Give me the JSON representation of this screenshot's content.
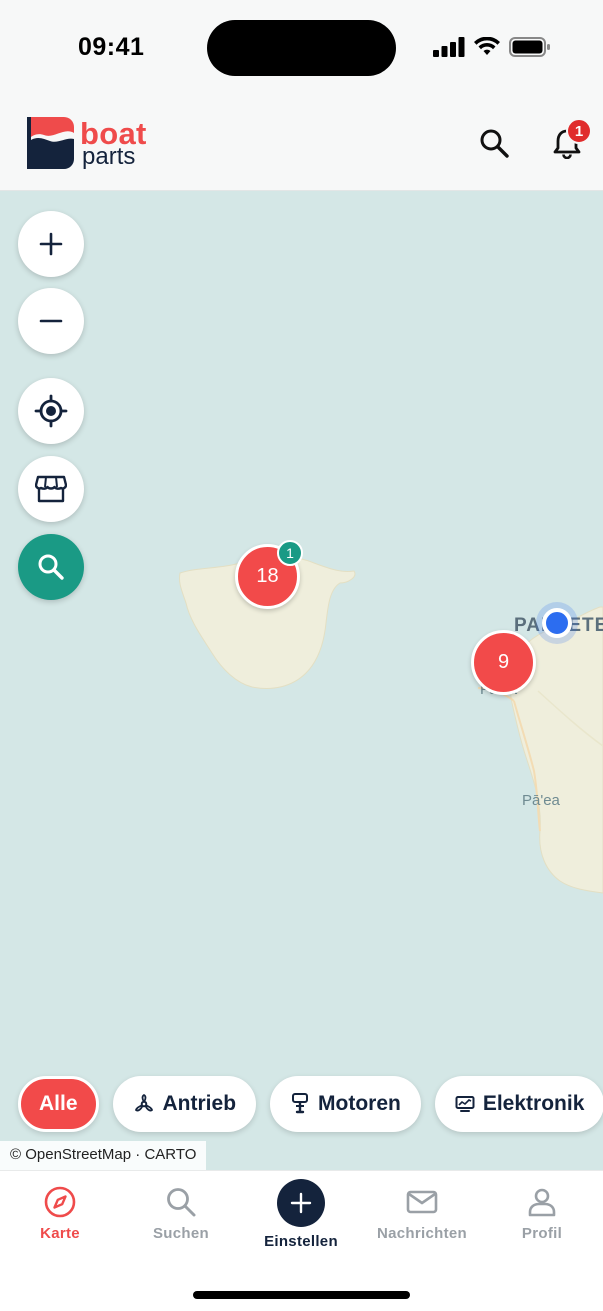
{
  "status_bar": {
    "time": "09:41"
  },
  "header": {
    "logo": {
      "word1": "boat",
      "word2": "parts"
    },
    "notification_count": "1"
  },
  "map": {
    "places": [
      "PAPEETE",
      "Faa'a",
      "Pā'ea"
    ],
    "clusters": [
      {
        "count": "18",
        "badge": "1"
      },
      {
        "count": "9"
      }
    ],
    "attribution": "© OpenStreetMap · CARTO"
  },
  "map_controls": [
    "zoom-in",
    "zoom-out",
    "locate",
    "shops",
    "search"
  ],
  "categories": [
    {
      "label": "Alle",
      "active": true
    },
    {
      "label": "Antrieb",
      "icon": "propeller-icon"
    },
    {
      "label": "Motoren",
      "icon": "outboard-motor-icon"
    },
    {
      "label": "Elektronik",
      "icon": "monitor-icon"
    }
  ],
  "nav": [
    {
      "label": "Karte",
      "icon": "compass-icon",
      "active": true
    },
    {
      "label": "Suchen",
      "icon": "search-icon"
    },
    {
      "label": "Einstellen",
      "icon": "plus-icon"
    },
    {
      "label": "Nachrichten",
      "icon": "mail-icon"
    },
    {
      "label": "Profil",
      "icon": "user-icon"
    }
  ],
  "colors": {
    "brand_red": "#f24a4a",
    "navy": "#14233c",
    "teal": "#1a9a85",
    "map_water": "#d4e7e6",
    "land": "#efeedc"
  }
}
